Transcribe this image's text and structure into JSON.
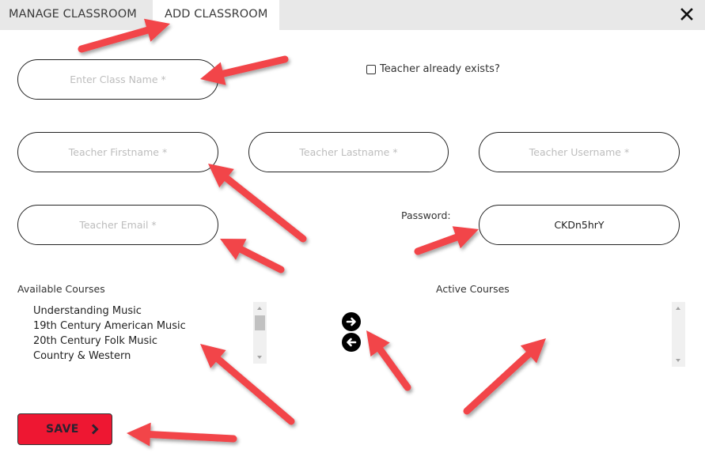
{
  "header": {
    "tabs": [
      {
        "label": "MANAGE CLASSROOM",
        "active": false
      },
      {
        "label": "ADD CLASSROOM",
        "active": true
      }
    ],
    "close_icon": "close-icon"
  },
  "form": {
    "class_name": {
      "placeholder": "Enter Class Name *",
      "value": ""
    },
    "teacher_exists": {
      "label": "Teacher already exists?",
      "checked": false
    },
    "teacher_firstname": {
      "placeholder": "Teacher Firstname *",
      "value": ""
    },
    "teacher_lastname": {
      "placeholder": "Teacher Lastname *",
      "value": ""
    },
    "teacher_username": {
      "placeholder": "Teacher Username *",
      "value": ""
    },
    "teacher_email": {
      "placeholder": "Teacher Email *",
      "value": ""
    },
    "password": {
      "label": "Password:",
      "value": "CKDn5hrY"
    }
  },
  "courses": {
    "available_label": "Available Courses",
    "active_label": "Active Courses",
    "available": [
      "Understanding Music",
      "19th Century American Music",
      "20th Century Folk Music",
      "Country & Western"
    ],
    "active": [],
    "add_icon": "arrow-right-circle-icon",
    "remove_icon": "arrow-left-circle-icon"
  },
  "actions": {
    "save_label": "SAVE",
    "save_icon": "chevron-right-icon"
  },
  "colors": {
    "save_button": "#ee1732",
    "annotation_arrow": "#f2444a",
    "tab_bar": "#e8e8e8"
  },
  "annotations": {
    "count": 9,
    "type": "red-arrow"
  }
}
